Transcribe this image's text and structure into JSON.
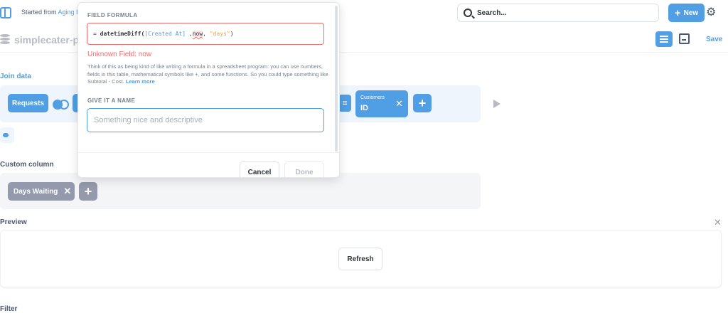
{
  "topbar": {
    "started_from_prefix": "Started from ",
    "started_from_link": "Aging I",
    "search_label": "Search...",
    "new_label": "New"
  },
  "header": {
    "question_title": "simplecater-p",
    "save_label": "Save"
  },
  "sections": {
    "join_data": "Join data",
    "custom_column": "Custom column",
    "preview": "Preview",
    "filter": "Filter"
  },
  "join": {
    "left_table": "Requests",
    "right_table_small": "Customers",
    "right_column": "ID",
    "equals": "="
  },
  "custom_column": {
    "column_name": "Days Waiting"
  },
  "preview": {
    "refresh_label": "Refresh"
  },
  "popover": {
    "formula_label": "FIELD FORMULA",
    "formula": {
      "prefix": "= ",
      "fn": "datetimeDiff(",
      "field": "[Created At]",
      "sep1": " ,",
      "bad": "now",
      "sep2": ", ",
      "str": "\"days\"",
      "close": ")"
    },
    "error": "Unknown Field: now",
    "help": "Think of this as being kind of like writing a formula in a spreadsheet program: you can use numbers, fields in this table, mathematical symbols like +, and some functions. So you could type something like Subtotal - Cost.",
    "learn_more": "Learn more",
    "name_label": "GIVE IT A NAME",
    "name_placeholder": "Something nice and descriptive",
    "cancel_label": "Cancel",
    "done_label": "Done"
  },
  "colors": {
    "brand": "#509ee3",
    "error": "#ed6e6e",
    "muted": "#949aab"
  }
}
